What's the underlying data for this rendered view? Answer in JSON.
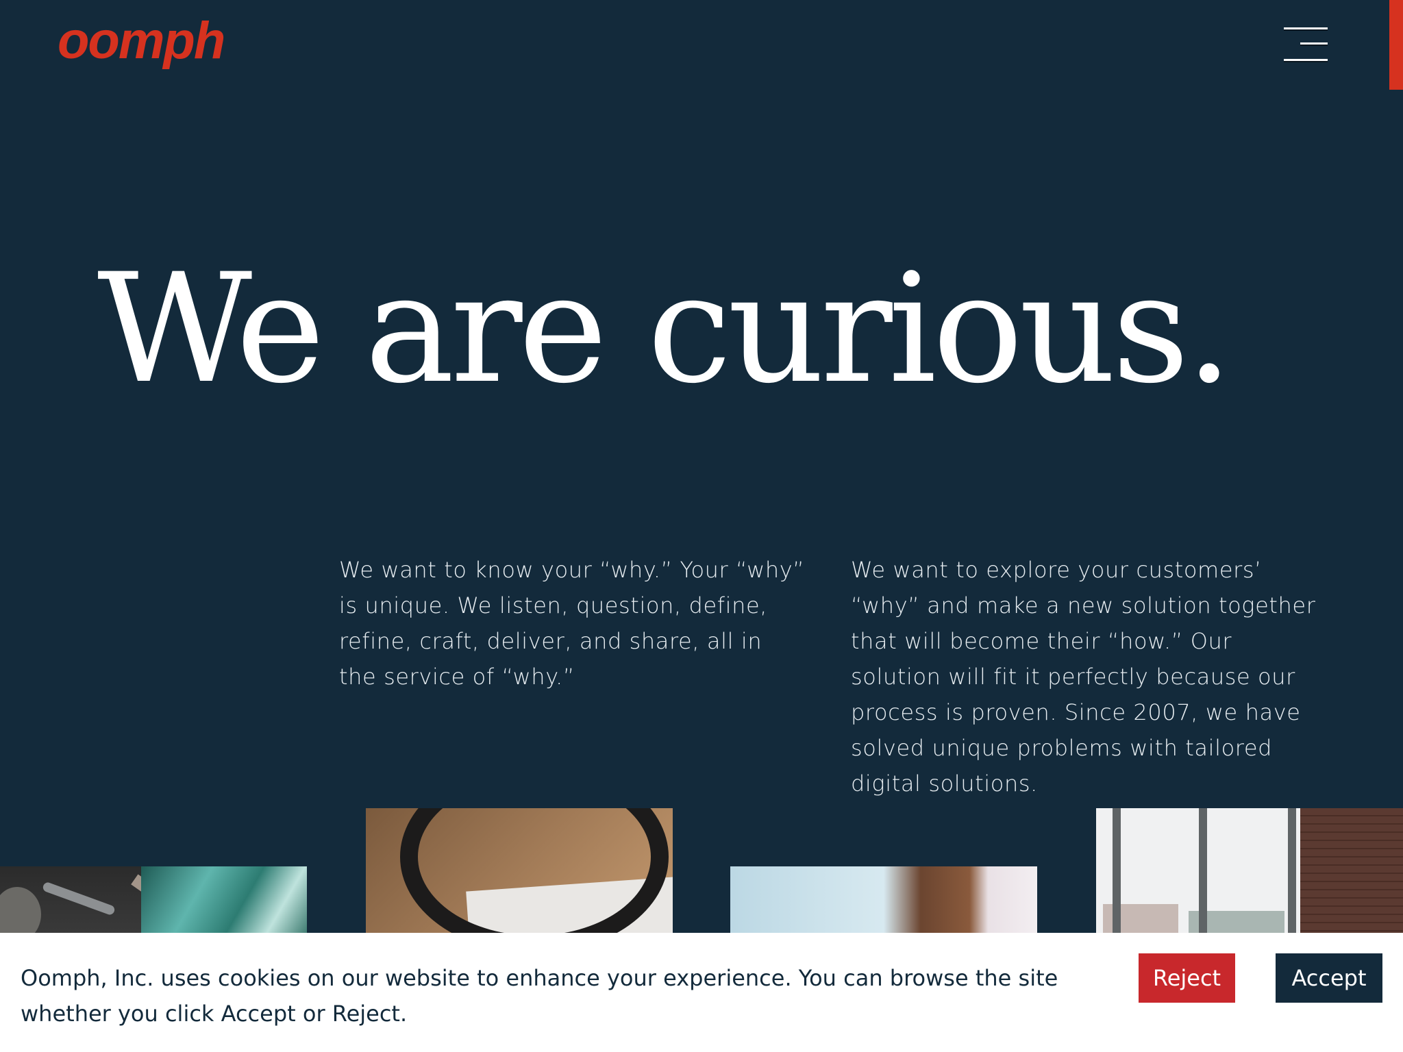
{
  "header": {
    "logo_text": "oomph",
    "menu_icon": "hamburger-menu-icon"
  },
  "hero": {
    "title": "We are curious."
  },
  "intro": {
    "left_paragraph": "We want to know your “why.” Your “why” is unique. We listen, question, define, refine, craft, deliver, and share, all in the service of “why.”",
    "right_paragraph": "We want to explore your customers’ “why” and make a new solution together that will become their “how.” Our solution will fit it perfectly because our process is proven. Since 2007, we have solved unique problems with tailored digital solutions."
  },
  "cookie_banner": {
    "message": "Oomph, Inc. uses cookies on our website to enhance your experience. You can browse the site whether you click Accept or Reject.",
    "reject_label": "Reject",
    "accept_label": "Accept"
  },
  "colors": {
    "background": "#132a3b",
    "brand_accent": "#d6321f",
    "reject_button": "#c8282c",
    "accept_button": "#132a3b",
    "banner_background": "#ffffff"
  }
}
